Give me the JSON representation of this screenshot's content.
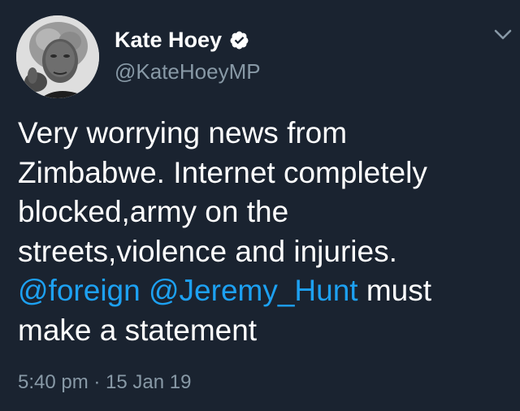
{
  "author": {
    "display_name": "Kate Hoey",
    "handle": "@KateHoeyMP",
    "verified": true
  },
  "tweet": {
    "lines": [
      "Very worrying news from",
      "Zimbabwe. Internet completely",
      "blocked,army on the",
      "streets,violence and injuries."
    ],
    "mention_1": "@foreign",
    "mention_2": "@Jeremy_Hunt",
    "line5_rest": " must",
    "line6": "make a statement"
  },
  "meta": {
    "time": "5:40 pm",
    "separator": " · ",
    "date": "15 Jan 19"
  },
  "icons": {
    "verified": "verified-badge-icon",
    "menu": "chevron-down-icon"
  },
  "colors": {
    "background": "#1a2330",
    "text": "#ffffff",
    "secondary": "#8899a6",
    "link": "#1da1f2"
  }
}
